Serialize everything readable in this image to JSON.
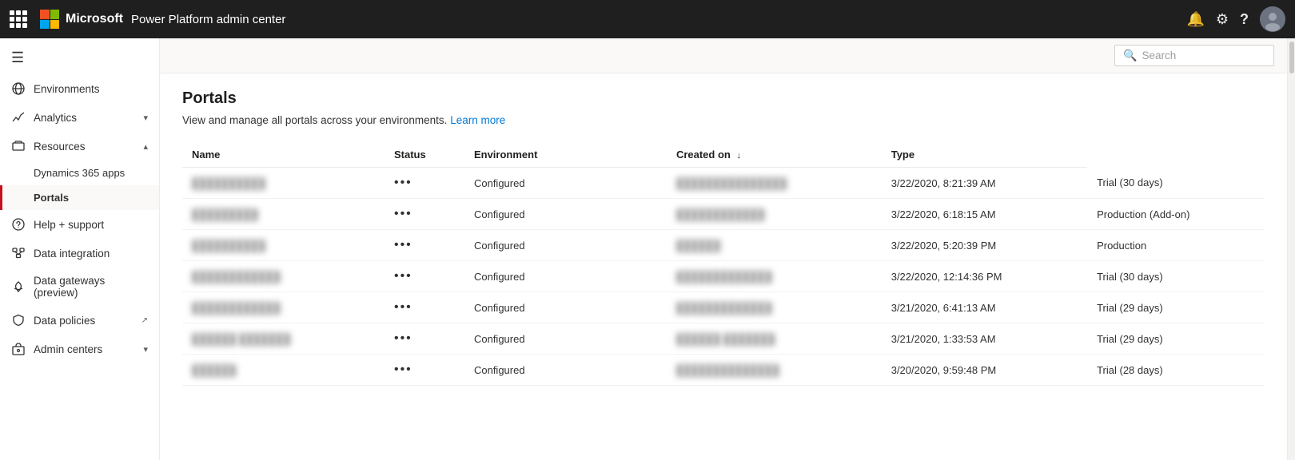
{
  "topnav": {
    "title": "Power Platform admin center",
    "search_label": "Search"
  },
  "sidebar": {
    "hamburger": "☰",
    "items": [
      {
        "id": "environments",
        "label": "Environments",
        "icon": "🌐",
        "has_chevron": false,
        "active": false
      },
      {
        "id": "analytics",
        "label": "Analytics",
        "icon": "📈",
        "has_chevron": true,
        "active": false
      },
      {
        "id": "resources",
        "label": "Resources",
        "icon": "📦",
        "has_chevron": true,
        "expanded": true,
        "active": false
      },
      {
        "id": "dynamics365apps",
        "label": "Dynamics 365 apps",
        "sub": true,
        "active": false
      },
      {
        "id": "portals",
        "label": "Portals",
        "sub": true,
        "active": true
      },
      {
        "id": "help-support",
        "label": "Help + support",
        "icon": "🎧",
        "active": false
      },
      {
        "id": "data-integration",
        "label": "Data integration",
        "icon": "🔗",
        "active": false
      },
      {
        "id": "data-gateways",
        "label": "Data gateways (preview)",
        "icon": "☁",
        "active": false
      },
      {
        "id": "data-policies",
        "label": "Data policies",
        "icon": "🛡",
        "has_external": true,
        "active": false
      },
      {
        "id": "admin-centers",
        "label": "Admin centers",
        "icon": "🏢",
        "has_chevron": true,
        "active": false
      }
    ]
  },
  "page": {
    "title": "Portals",
    "subtitle": "View and manage all portals across your environments.",
    "learn_more": "Learn more"
  },
  "table": {
    "columns": [
      {
        "id": "name",
        "label": "Name"
      },
      {
        "id": "status",
        "label": "Status"
      },
      {
        "id": "environment",
        "label": "Environment"
      },
      {
        "id": "created_on",
        "label": "Created on",
        "sorted": true
      },
      {
        "id": "type",
        "label": "Type"
      }
    ],
    "rows": [
      {
        "name": "██████████",
        "status": "Configured",
        "environment": "███████████████",
        "created_on": "3/22/2020, 8:21:39 AM",
        "type": "Trial (30 days)"
      },
      {
        "name": "█████████",
        "status": "Configured",
        "environment": "████████████",
        "created_on": "3/22/2020, 6:18:15 AM",
        "type": "Production (Add-on)"
      },
      {
        "name": "██████████",
        "status": "Configured",
        "environment": "██████",
        "created_on": "3/22/2020, 5:20:39 PM",
        "type": "Production"
      },
      {
        "name": "████████████",
        "status": "Configured",
        "environment": "█████████████",
        "created_on": "3/22/2020, 12:14:36 PM",
        "type": "Trial (30 days)"
      },
      {
        "name": "████████████",
        "status": "Configured",
        "environment": "█████████████",
        "created_on": "3/21/2020, 6:41:13 AM",
        "type": "Trial (29 days)"
      },
      {
        "name": "██████ ███████",
        "status": "Configured",
        "environment": "██████ ███████",
        "created_on": "3/21/2020, 1:33:53 AM",
        "type": "Trial (29 days)"
      },
      {
        "name": "██████",
        "status": "Configured",
        "environment": "██████████████",
        "created_on": "3/20/2020, 9:59:48 PM",
        "type": "Trial (28 days)"
      }
    ]
  }
}
